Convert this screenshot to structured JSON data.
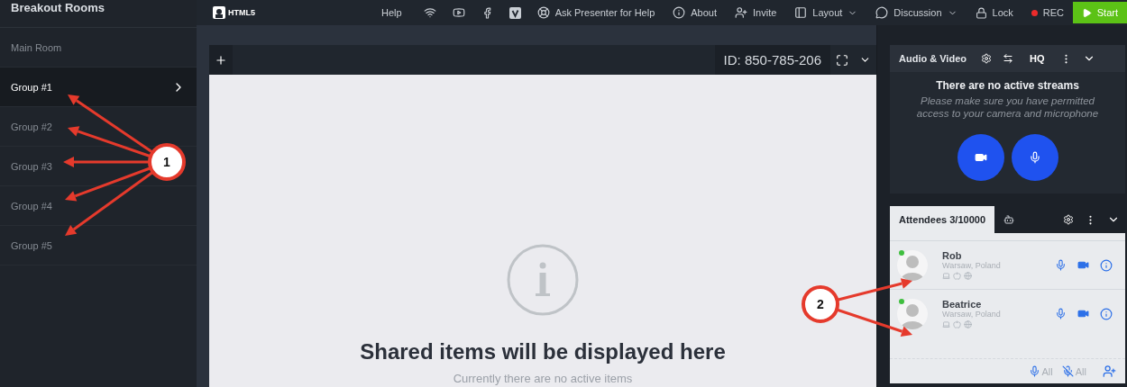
{
  "sidebar": {
    "title": "Breakout Rooms",
    "items": [
      {
        "label": "Main Room",
        "selected": false
      },
      {
        "label": "Group #1",
        "selected": true
      },
      {
        "label": "Group #2",
        "selected": false
      },
      {
        "label": "Group #3",
        "selected": false
      },
      {
        "label": "Group #4",
        "selected": false
      },
      {
        "label": "Group #5",
        "selected": false
      }
    ]
  },
  "topbar": {
    "logo": "HTML5",
    "help": "Help",
    "ask": "Ask Presenter for Help",
    "about": "About",
    "invite": "Invite",
    "layout": "Layout",
    "discussion": "Discussion",
    "lock": "Lock",
    "rec": "REC",
    "start": "Start"
  },
  "stage": {
    "id": "ID: 850-785-206",
    "empty_title": "Shared items will be displayed here",
    "empty_subtitle": "Currently there are no active items"
  },
  "audio_video": {
    "title": "Audio & Video",
    "quality": "HQ",
    "message": "There are no active streams",
    "hint": "Please make sure you have permitted access to your camera and microphone"
  },
  "attendees": {
    "tabs": [
      {
        "label": "Attendees 3/10000",
        "selected": true
      },
      {
        "selected": false
      }
    ],
    "people": [
      {
        "name": "Rob",
        "location": "Warsaw, Poland",
        "online": true
      },
      {
        "name": "Beatrice",
        "location": "Warsaw, Poland",
        "online": true
      }
    ],
    "footer": {
      "mute_all": "All",
      "unmute_all": "All"
    }
  },
  "callouts": [
    {
      "label": "1"
    },
    {
      "label": "2"
    }
  ]
}
